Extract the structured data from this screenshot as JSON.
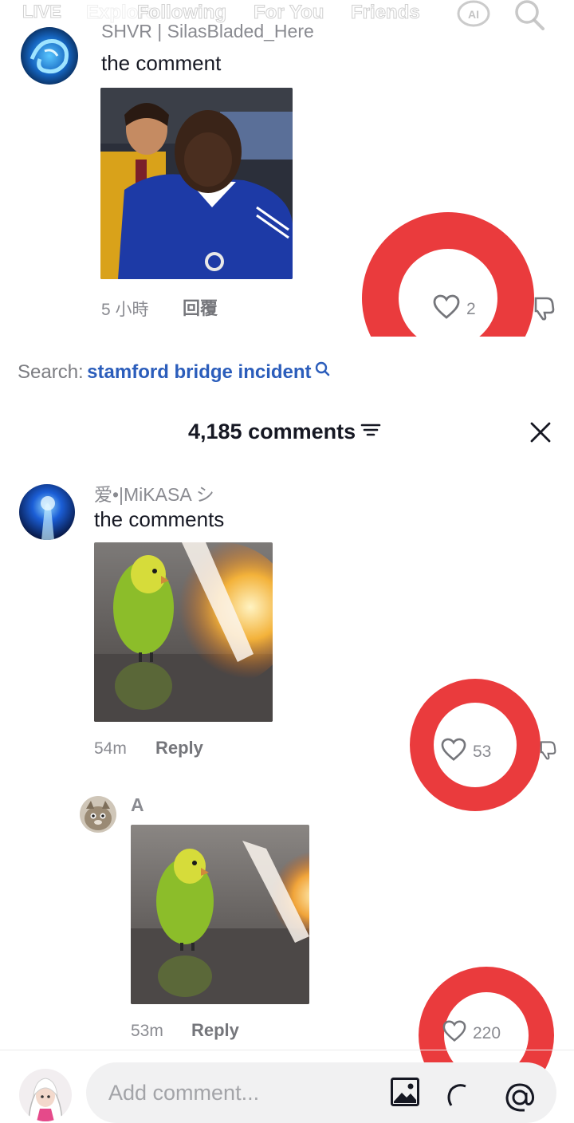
{
  "top_nav": {
    "tabs": [
      "LIVE",
      "Explore",
      "Following",
      "For You",
      "Friends"
    ],
    "badge": "AI"
  },
  "top_comment": {
    "username": "SHVR | SilasBladed_Here",
    "text": "the comment",
    "time": "5 小時",
    "reply_label": "回覆",
    "likes": "2"
  },
  "search_suggestion": {
    "prefix": "Search:",
    "query": "stamford bridge incident"
  },
  "comments_header": {
    "title": "4,185 comments"
  },
  "comments": [
    {
      "username": "爱•|MiKASA シ",
      "text": "the comments",
      "time": "54m",
      "reply_label": "Reply",
      "likes": "53"
    }
  ],
  "reply": {
    "username": "A",
    "time": "53m",
    "reply_label": "Reply",
    "likes": "220"
  },
  "composer": {
    "placeholder": "Add comment..."
  },
  "colors": {
    "annotation": "#ea3b3d",
    "link": "#2b5dbb",
    "muted_text": "#8a8b91"
  }
}
